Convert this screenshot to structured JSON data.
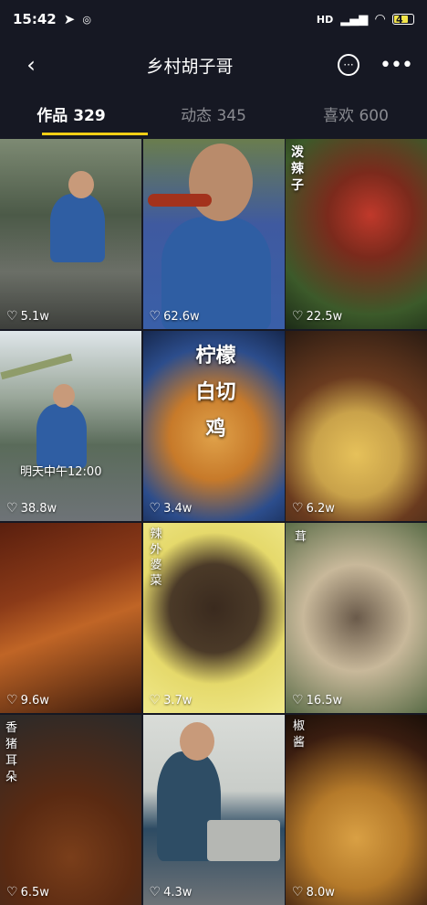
{
  "status": {
    "time": "15:42",
    "network": "HD",
    "battery": "4"
  },
  "nav": {
    "back_icon": "chevron-left-icon",
    "title": "乡村胡子哥",
    "chat_icon": "chat-bubble-icon",
    "more_icon": "more-dots-icon"
  },
  "tabs": [
    {
      "label": "作品 329",
      "active": true
    },
    {
      "label": "动态 345",
      "active": false
    },
    {
      "label": "喜欢 600",
      "active": false
    }
  ],
  "videos": [
    {
      "likes": "5.1w",
      "text": ""
    },
    {
      "likes": "62.6w",
      "text": ""
    },
    {
      "likes": "22.5w",
      "text": "泼辣子"
    },
    {
      "likes": "38.8w",
      "text": "明天中午12:00"
    },
    {
      "likes": "3.4w",
      "text": "柠檬白切鸡"
    },
    {
      "likes": "6.2w",
      "text": ""
    },
    {
      "likes": "9.6w",
      "text": ""
    },
    {
      "likes": "3.7w",
      "text": "辣外婆菜"
    },
    {
      "likes": "16.5w",
      "text": "茸"
    },
    {
      "likes": "6.5w",
      "text": "香猪耳朵"
    },
    {
      "likes": "4.3w",
      "text": ""
    },
    {
      "likes": "8.0w",
      "text": "椒酱"
    }
  ],
  "colors": {
    "background": "#161823",
    "accent": "#face15",
    "inactive_tab": "#8a8b91"
  }
}
